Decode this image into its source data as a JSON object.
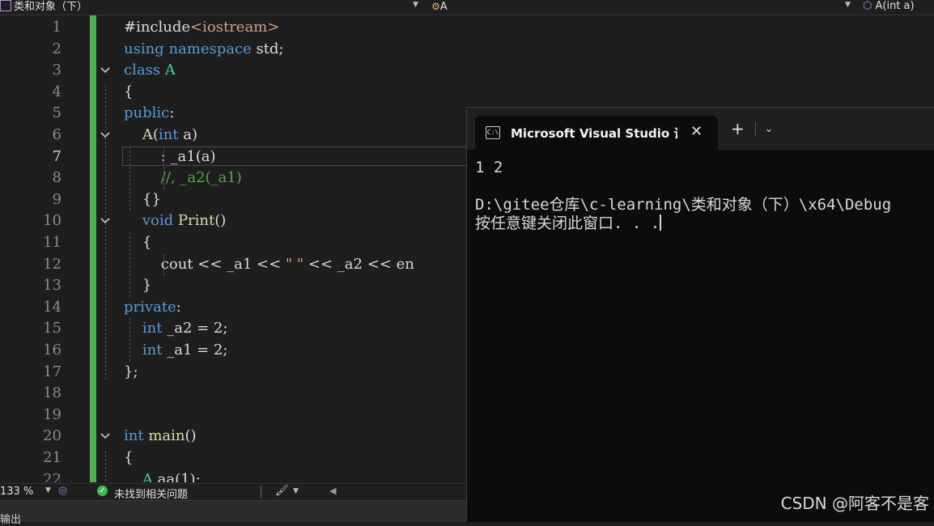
{
  "navbar": {
    "project": "类和对象（下）",
    "scope": "A",
    "member": "A(int a)"
  },
  "editor": {
    "lines": [
      {
        "n": "1",
        "current": false,
        "fold": "",
        "tokens": [
          {
            "t": "#include",
            "c": "pl"
          },
          {
            "t": "<iostream>",
            "c": "st"
          }
        ]
      },
      {
        "n": "2",
        "current": false,
        "fold": "",
        "tokens": [
          {
            "t": "using",
            "c": "kw"
          },
          {
            "t": " ",
            "c": "pl"
          },
          {
            "t": "namespace",
            "c": "kw"
          },
          {
            "t": " std;",
            "c": "pl"
          }
        ]
      },
      {
        "n": "3",
        "current": false,
        "fold": "open",
        "tokens": [
          {
            "t": "class",
            "c": "kw"
          },
          {
            "t": " ",
            "c": "pl"
          },
          {
            "t": "A",
            "c": "ty"
          }
        ]
      },
      {
        "n": "4",
        "current": false,
        "fold": "",
        "tokens": [
          {
            "t": "{",
            "c": "pl"
          }
        ]
      },
      {
        "n": "5",
        "current": false,
        "fold": "",
        "tokens": [
          {
            "t": "public",
            "c": "kw"
          },
          {
            "t": ":",
            "c": "pl"
          }
        ]
      },
      {
        "n": "6",
        "current": false,
        "fold": "open",
        "tokens": [
          {
            "t": "    ",
            "c": "pl"
          },
          {
            "t": "A",
            "c": "fn"
          },
          {
            "t": "(",
            "c": "pl"
          },
          {
            "t": "int",
            "c": "kw"
          },
          {
            "t": " a)",
            "c": "pl"
          }
        ]
      },
      {
        "n": "7",
        "current": true,
        "fold": "",
        "tokens": [
          {
            "t": "        : _a1(a)",
            "c": "pl"
          }
        ]
      },
      {
        "n": "8",
        "current": false,
        "fold": "",
        "tokens": [
          {
            "t": "        ",
            "c": "pl"
          },
          {
            "t": "//, _a2(_a1)",
            "c": "cm"
          }
        ]
      },
      {
        "n": "9",
        "current": false,
        "fold": "",
        "tokens": [
          {
            "t": "    {}",
            "c": "pl"
          }
        ]
      },
      {
        "n": "10",
        "current": false,
        "fold": "open",
        "tokens": [
          {
            "t": "    ",
            "c": "pl"
          },
          {
            "t": "void",
            "c": "kw"
          },
          {
            "t": " ",
            "c": "pl"
          },
          {
            "t": "Print",
            "c": "fn"
          },
          {
            "t": "()",
            "c": "pl"
          }
        ]
      },
      {
        "n": "11",
        "current": false,
        "fold": "",
        "tokens": [
          {
            "t": "    {",
            "c": "pl"
          }
        ]
      },
      {
        "n": "12",
        "current": false,
        "fold": "",
        "tokens": [
          {
            "t": "        cout << _a1 << ",
            "c": "pl"
          },
          {
            "t": "\" \"",
            "c": "st"
          },
          {
            "t": " << _a2 << en",
            "c": "pl"
          }
        ]
      },
      {
        "n": "13",
        "current": false,
        "fold": "",
        "tokens": [
          {
            "t": "    }",
            "c": "pl"
          }
        ]
      },
      {
        "n": "14",
        "current": false,
        "fold": "",
        "tokens": [
          {
            "t": "private",
            "c": "kw"
          },
          {
            "t": ":",
            "c": "pl"
          }
        ]
      },
      {
        "n": "15",
        "current": false,
        "fold": "",
        "tokens": [
          {
            "t": "    ",
            "c": "pl"
          },
          {
            "t": "int",
            "c": "kw"
          },
          {
            "t": " _a2 = 2;",
            "c": "pl"
          }
        ]
      },
      {
        "n": "16",
        "current": false,
        "fold": "",
        "tokens": [
          {
            "t": "    ",
            "c": "pl"
          },
          {
            "t": "int",
            "c": "kw"
          },
          {
            "t": " _a1 = 2;",
            "c": "pl"
          }
        ]
      },
      {
        "n": "17",
        "current": false,
        "fold": "",
        "tokens": [
          {
            "t": "};",
            "c": "pl"
          }
        ]
      },
      {
        "n": "18",
        "current": false,
        "fold": "",
        "tokens": []
      },
      {
        "n": "19",
        "current": false,
        "fold": "",
        "tokens": []
      },
      {
        "n": "20",
        "current": false,
        "fold": "open",
        "tokens": [
          {
            "t": "int",
            "c": "kw"
          },
          {
            "t": " ",
            "c": "pl"
          },
          {
            "t": "main",
            "c": "fn"
          },
          {
            "t": "()",
            "c": "pl"
          }
        ]
      },
      {
        "n": "21",
        "current": false,
        "fold": "",
        "tokens": [
          {
            "t": "{",
            "c": "pl"
          }
        ]
      },
      {
        "n": "22",
        "current": false,
        "fold": "",
        "tokens": [
          {
            "t": "    ",
            "c": "pl"
          },
          {
            "t": "A",
            "c": "ty"
          },
          {
            "t": " aa(1);",
            "c": "pl"
          }
        ]
      }
    ]
  },
  "status": {
    "zoom": "133 %",
    "issues": "未找到相关问题",
    "output_label": "输出"
  },
  "terminal": {
    "tab_title": "Microsoft Visual Studio 调试控",
    "new_tab": "+",
    "output": [
      "1 2",
      "",
      "D:\\gitee仓库\\c-learning\\类和对象（下）\\x64\\Debug",
      "按任意键关闭此窗口. . ."
    ]
  },
  "watermark": "CSDN @阿客不是客",
  "colors": {
    "accent_green": "#4caf50",
    "check_green": "#3fb950"
  }
}
